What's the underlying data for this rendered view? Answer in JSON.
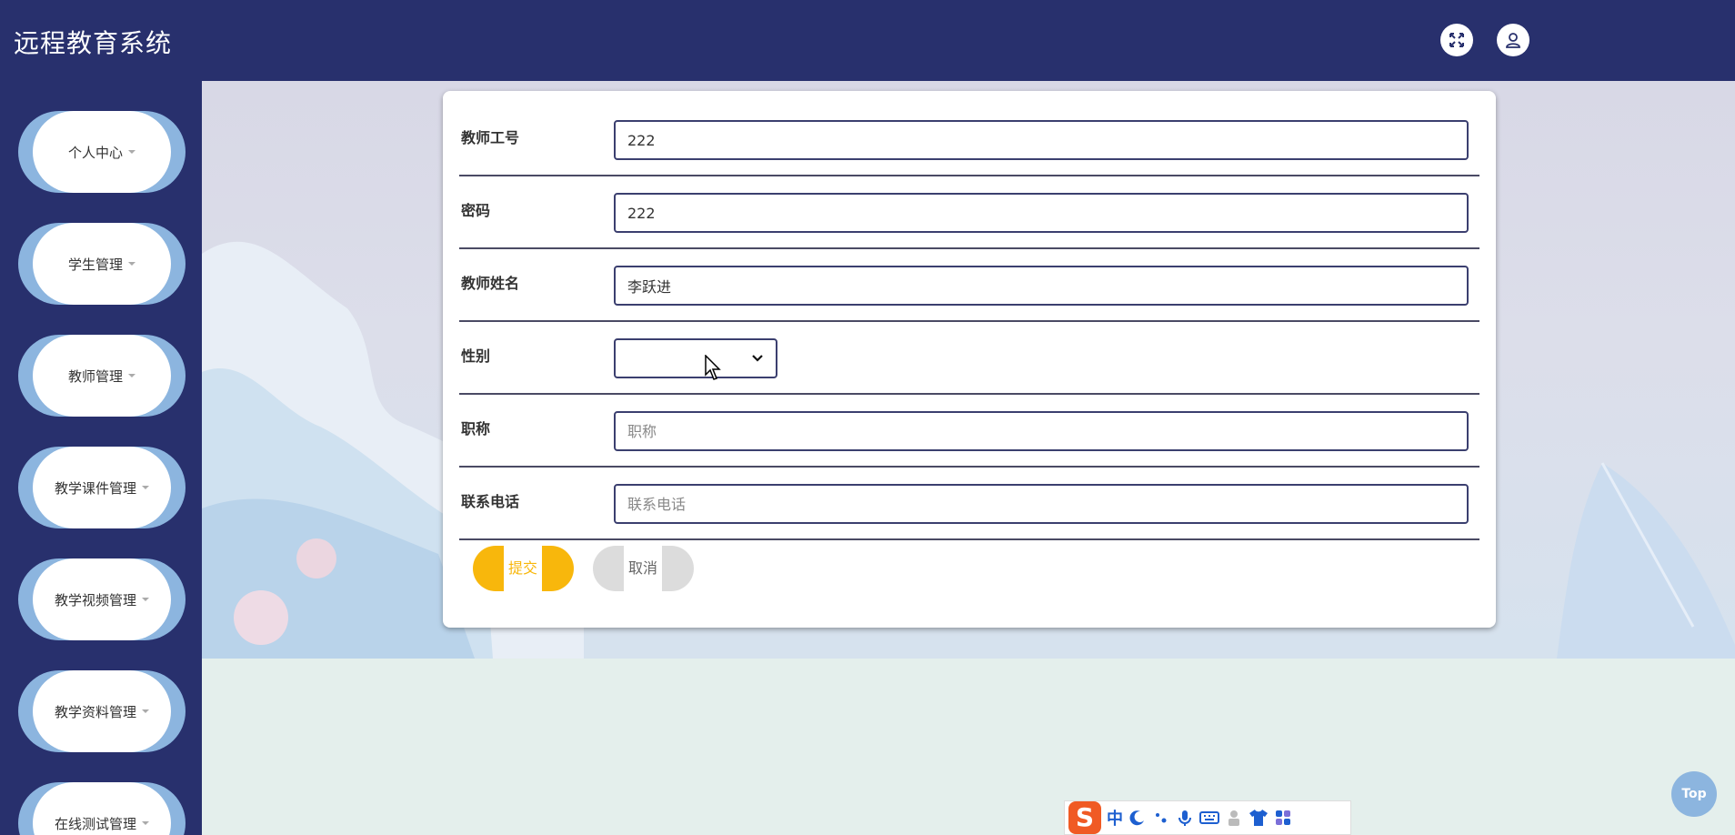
{
  "header": {
    "title": "远程教育系统",
    "icons": [
      "fullscreen-icon",
      "user-icon"
    ]
  },
  "sidebar": {
    "items": [
      {
        "label": "个人中心"
      },
      {
        "label": "学生管理"
      },
      {
        "label": "教师管理"
      },
      {
        "label": "教学课件管理"
      },
      {
        "label": "教学视频管理"
      },
      {
        "label": "教学资料管理"
      },
      {
        "label": "在线测试管理"
      }
    ]
  },
  "form": {
    "fields": [
      {
        "label": "教师工号",
        "value": "222",
        "placeholder": ""
      },
      {
        "label": "密码",
        "value": "222",
        "placeholder": ""
      },
      {
        "label": "教师姓名",
        "value": "李跃进",
        "placeholder": ""
      },
      {
        "label": "性别",
        "value": ""
      },
      {
        "label": "职称",
        "value": "",
        "placeholder": "职称"
      },
      {
        "label": "联系电话",
        "value": "",
        "placeholder": "联系电话"
      }
    ],
    "submit_label": "提交",
    "cancel_label": "取消"
  },
  "top_button": "Top",
  "ime_toolbar": {
    "logo": "S",
    "mode": "中",
    "icons": [
      "moon-icon",
      "punctuation-icon",
      "microphone-icon",
      "keyboard-icon",
      "person-icon",
      "shirt-icon",
      "apps-icon"
    ]
  },
  "colors": {
    "header_bg": "#28306d",
    "sidebar_accent": "#8cb5df",
    "submit": "#f8b70c",
    "cancel": "#dcdcdc"
  }
}
